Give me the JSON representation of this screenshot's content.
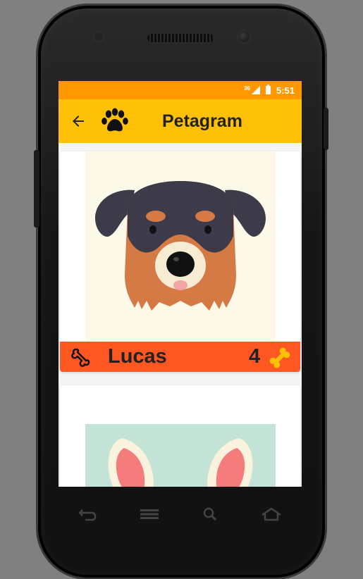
{
  "status": {
    "network": "36",
    "time": "5:51"
  },
  "toolbar": {
    "title": "Petagram",
    "back_icon": "arrow-back-icon",
    "logo_icon": "paw-icon"
  },
  "pets": [
    {
      "name": "Lucas",
      "likes": "4"
    }
  ],
  "colors": {
    "status_bar": "#FF9800",
    "toolbar": "#FFC107",
    "pet_bar": "#FF5722",
    "bone": "#FFC107"
  },
  "nav": [
    "back-icon",
    "menu-icon",
    "search-icon",
    "home-icon"
  ]
}
